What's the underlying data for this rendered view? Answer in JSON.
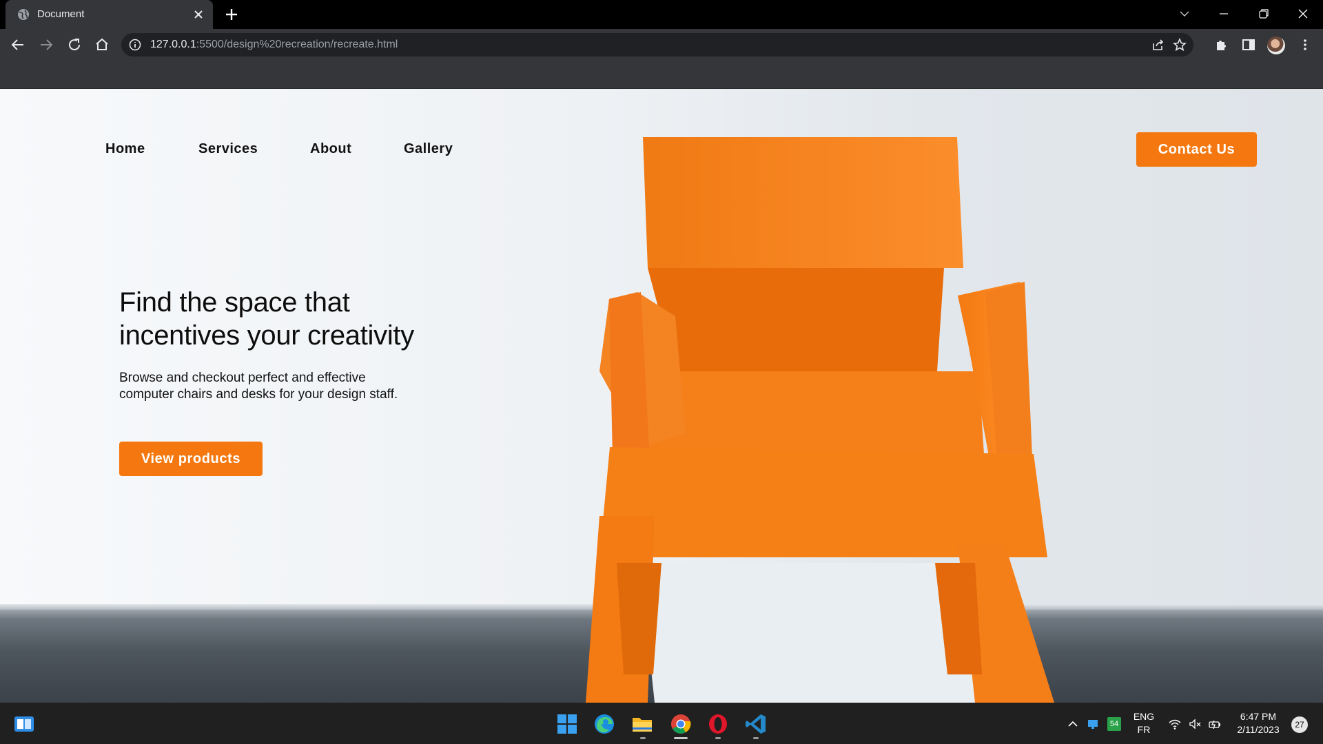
{
  "browser": {
    "tab_title": "Document",
    "url_host": "127.0.0.1",
    "url_rest": ":5500/design%20recreation/recreate.html"
  },
  "page": {
    "nav": [
      "Home",
      "Services",
      "About",
      "Gallery"
    ],
    "contact_label": "Contact Us",
    "hero_title_line1": "Find the space that",
    "hero_title_line2": "incentives your creativity",
    "hero_subtitle": "Browse and checkout perfect and effective computer chairs and desks for your design staff.",
    "cta_label": "View products",
    "accent_color": "#f4780f"
  },
  "taskbar": {
    "apps": [
      "widgets-icon",
      "windows-start-icon",
      "edge-icon",
      "file-explorer-icon",
      "chrome-icon",
      "opera-icon",
      "vscode-icon"
    ],
    "tray_badge": "54",
    "lang_line1": "ENG",
    "lang_line2": "FR",
    "time": "6:47 PM",
    "date": "2/11/2023",
    "notifications": "27"
  }
}
